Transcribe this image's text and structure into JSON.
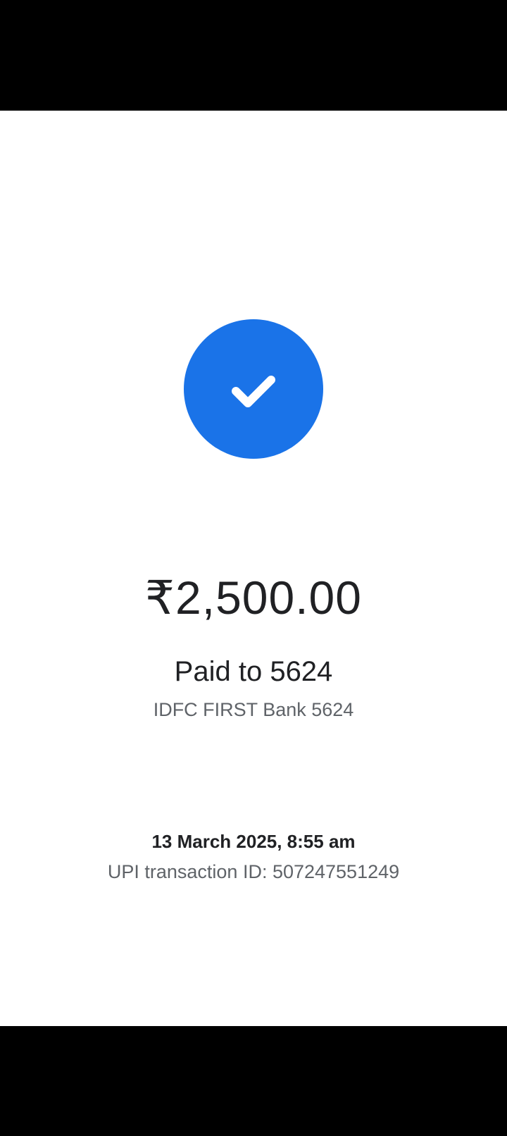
{
  "payment": {
    "status_icon": "check-icon",
    "amount": "₹2,500.00",
    "paid_to": "Paid to 5624",
    "bank": "IDFC FIRST Bank 5624",
    "timestamp": "13 March 2025, 8:55 am",
    "transaction_id": "UPI transaction ID: 507247551249"
  },
  "colors": {
    "accent": "#1a73e8",
    "text_primary": "#202124",
    "text_secondary": "#5f6368",
    "background": "#ffffff",
    "bars": "#000000"
  }
}
